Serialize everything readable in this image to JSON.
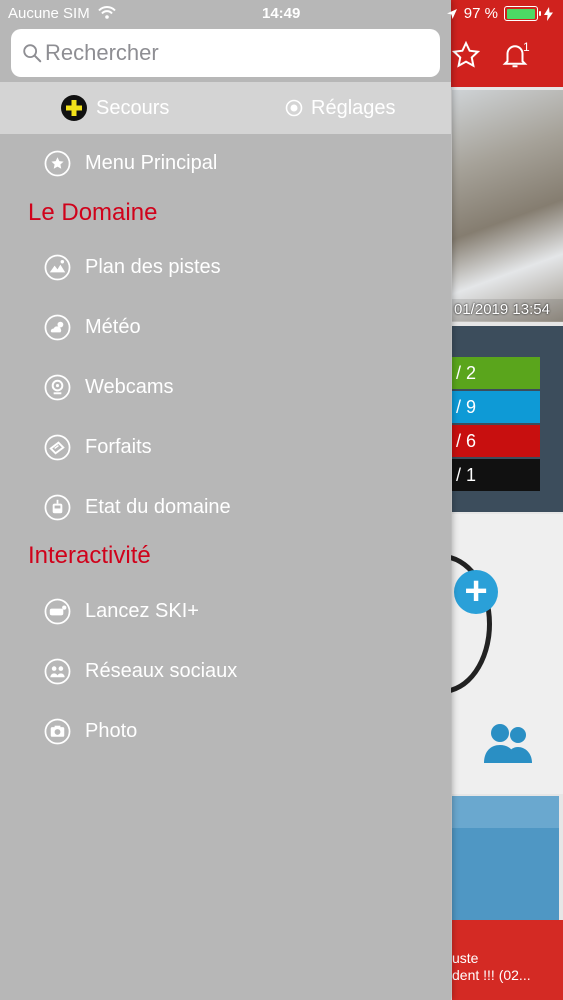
{
  "status_bar": {
    "carrier": "Aucune SIM",
    "time": "14:49",
    "battery_percent": "97 %",
    "battery_level": 0.97
  },
  "search": {
    "placeholder": "Rechercher"
  },
  "tabs": [
    {
      "label": "Secours"
    },
    {
      "label": "Réglages"
    }
  ],
  "menu": {
    "main_item": {
      "label": "Menu Principal",
      "icon": "star-icon"
    },
    "sections": [
      {
        "title": "Le Domaine",
        "items": [
          {
            "label": "Plan des pistes",
            "icon": "mountain-map-icon"
          },
          {
            "label": "Météo",
            "icon": "weather-icon"
          },
          {
            "label": "Webcams",
            "icon": "webcam-icon"
          },
          {
            "label": "Forfaits",
            "icon": "ticket-icon"
          },
          {
            "label": "Etat du domaine",
            "icon": "cable-car-icon"
          }
        ]
      },
      {
        "title": "Interactivité",
        "items": [
          {
            "label": "Lancez SKI+",
            "icon": "ski-plus-icon"
          },
          {
            "label": "Réseaux sociaux",
            "icon": "social-icon"
          },
          {
            "label": "Photo",
            "icon": "camera-icon"
          }
        ]
      }
    ]
  },
  "background": {
    "webcam_date": "01/2019 13:54",
    "pistes": [
      {
        "text": "/ 2",
        "color": "#5aa51c"
      },
      {
        "text": "/ 9",
        "color": "#0e9ad6"
      },
      {
        "text": "/ 6",
        "color": "#c80f0f"
      },
      {
        "text": "/ 1",
        "color": "#111111"
      }
    ],
    "notification_count": "1",
    "news_line1": "uste",
    "news_line2": "dent !!! (02..."
  },
  "colors": {
    "accent_red": "#d0021b",
    "header_red": "#d0221e",
    "drawer_bg": "#b7b7b7"
  }
}
